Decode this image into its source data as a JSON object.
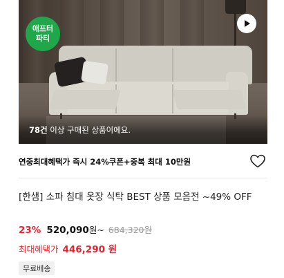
{
  "product_image": {
    "badge_line1": "애프터",
    "badge_line2": "파티",
    "purchase_count": "78건",
    "purchase_suffix": " 이상 구매된 상품이에요."
  },
  "benefit": {
    "text": "연중최대혜택가 즉시 24%쿠폰+중복 최대 10만원"
  },
  "product": {
    "title": "[한샘] 소파 침대 옷장 식탁 BEST 상품 모음전 ~49% OFF",
    "discount_rate": "23%",
    "price": "520,090",
    "price_unit": "원~",
    "original_price": "684,320원",
    "max_benefit_label": "최대혜택가",
    "max_benefit_price": "446,290 원",
    "shipping_tag": "무료배송"
  },
  "colors": {
    "badge_green": "#1fa74a",
    "discount_red": "#e8232f",
    "muted_gray": "#999999"
  },
  "icons": [
    "play-icon",
    "heart-icon"
  ]
}
